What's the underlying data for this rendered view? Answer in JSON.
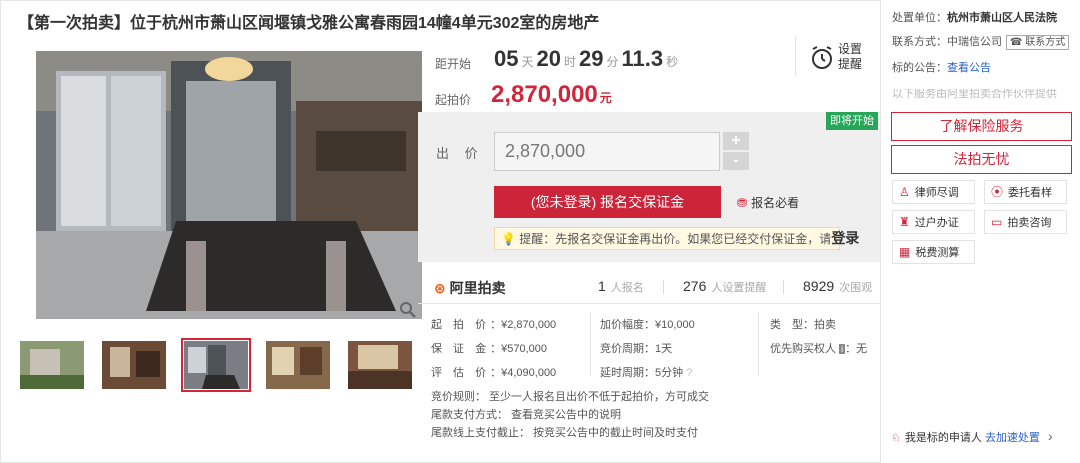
{
  "title": "【第一次拍卖】位于杭州市萧山区闻堰镇戈雅公寓春雨园14幢4单元302室的房地产",
  "countdown": {
    "label": "距开始",
    "days": "05",
    "days_unit": "天",
    "hours": "20",
    "hours_unit": "时",
    "minutes": "29",
    "minutes_unit": "分",
    "seconds": "11.3",
    "seconds_unit": "秒"
  },
  "reminder": {
    "label_line1": "设置",
    "label_line2": "提醒",
    "icon": "alarm-clock-icon"
  },
  "start_price": {
    "label": "起拍价",
    "value": "2,870,000",
    "unit": "元"
  },
  "status_badge": "即将开始",
  "bid": {
    "label": "出 价",
    "value": "2,870,000",
    "plus": "+",
    "minus": "-"
  },
  "register_button": "(您未登录) 报名交保证金",
  "must_read": "报名必看",
  "tip": {
    "prefix": "提醒：先报名交保证金再出价。如果您已经交付保证金，请",
    "login": "登录"
  },
  "stats": {
    "brand": "阿里拍卖",
    "signups": "1",
    "signups_label": "人报名",
    "reminders": "276",
    "reminders_label": "人设置提醒",
    "views": "8929",
    "views_label": "次围观"
  },
  "details": {
    "start_price": {
      "k": "起 拍 价",
      "v": "¥2,870,000"
    },
    "deposit": {
      "k": "保 证 金",
      "v": "¥570,000"
    },
    "appraisal": {
      "k": "评 估 价",
      "v": "¥4,090,000"
    },
    "increment": {
      "k": "加价幅度",
      "v": "¥10,000"
    },
    "period": {
      "k": "竞价周期",
      "v": "1天"
    },
    "delay": {
      "k": "延时周期",
      "v": "5分钟"
    },
    "type": {
      "k": "类　型",
      "v": "拍卖"
    },
    "priority": {
      "k": "优先购买权人",
      "v": "无"
    }
  },
  "rules": [
    "竞价规则： 至少一人报名且出价不低于起拍价，方可成交",
    "尾款支付方式： 查看竞买公告中的说明",
    "尾款线上支付截止： 按竞买公告中的截止时间及时支付"
  ],
  "sidebar": {
    "court_label": "处置单位：",
    "court": "杭州市萧山区人民法院",
    "contact_label": "联系方式：",
    "contact": "中瑞信公司",
    "contact_badge": "联系方式",
    "notice_label": "标的公告：",
    "notice_link": "查看公告",
    "faded": "以下服务由阿里拍卖合作伙伴提供",
    "insurance": "了解保险服务",
    "legal": "法拍无忧",
    "services": [
      "律师尽调",
      "委托看样",
      "过户办证",
      "拍卖咨询",
      "税费测算"
    ],
    "applicant_prefix": "我是标的申请人",
    "applicant_link": "去加速处置"
  },
  "colors": {
    "accent": "#d3253a",
    "badge": "#27a65a",
    "link": "#2962c9"
  }
}
